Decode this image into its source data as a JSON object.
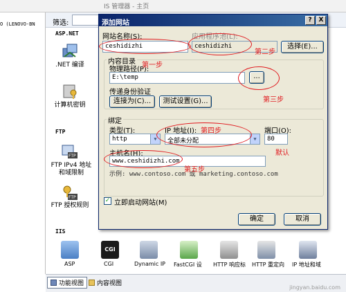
{
  "background": {
    "title_fragment": "IS 管理器 - 主页",
    "left_tree_text": "O (LENOVO-BN",
    "left_tree_text_right": "(LENOVO-BN",
    "filter_label": "筛选:",
    "sections": {
      "aspnet": "ASP.NET",
      "ftp": "FTP",
      "iis": "IIS"
    },
    "pane_icons": [
      {
        "label": ".NET 编译",
        "icon": "dotnet-compile-icon"
      },
      {
        "label": "计算机密钥",
        "icon": "machine-key-icon"
      },
      {
        "label": "FTP IPv4 地址和域限制",
        "icon": "ftp-ipv4-icon"
      },
      {
        "label": "FTP 授权规则",
        "icon": "ftp-authorization-icon"
      }
    ],
    "bottom_icons": [
      {
        "label": "ASP",
        "icon": "asp-icon"
      },
      {
        "label": "CGI",
        "icon": "cgi-icon"
      },
      {
        "label": "Dynamic IP",
        "icon": "dynamic-ip-icon"
      },
      {
        "label": "FastCGI 设",
        "icon": "fastcgi-icon"
      },
      {
        "label": "HTTP 响应标",
        "icon": "http-response-headers-icon"
      },
      {
        "label": "HTTP 重定向",
        "icon": "http-redirect-icon"
      },
      {
        "label": "IP 地址和域",
        "icon": "ip-domain-icon"
      }
    ],
    "status_tabs": [
      {
        "label": "功能视图",
        "icon": "features-view-icon",
        "active": true
      },
      {
        "label": "内容视图",
        "icon": "content-view-icon",
        "active": false
      }
    ],
    "watermark": "jingyan.baidu.com"
  },
  "dialog": {
    "title": "添加网站",
    "help_button": "?",
    "close_button": "X",
    "site_name": {
      "label": "网站名称(S):",
      "value": "ceshidizhi"
    },
    "app_pool": {
      "label": "应用程序池(L):",
      "value": "ceshidizhi",
      "select_button": "选择(E)..."
    },
    "content_dir": {
      "legend": "内容目录",
      "physical_path_label": "物理路径(P):",
      "physical_path_value": "E:\\temp",
      "browse_button": "...",
      "passthrough_label": "传递身份验证",
      "connect_as_button": "连接为(C)...",
      "test_settings_button": "测试设置(G)..."
    },
    "binding": {
      "legend": "绑定",
      "type_label": "类型(T):",
      "type_value": "http",
      "ip_label": "IP 地址(I):",
      "ip_value": "全部未分配",
      "port_label": "端口(O):",
      "port_value": "80",
      "hostname_label": "主机名(H):",
      "hostname_value": "www.ceshidizhi.com",
      "example_text": "示例: www.contoso.com 或 marketing.contoso.com"
    },
    "start_immediately": {
      "label": "立即启动网站(M)",
      "checked": true
    },
    "ok_button": "确定",
    "cancel_button": "取消"
  },
  "annotations": {
    "step1": "第一步",
    "step2": "第二步",
    "step3": "第三步",
    "step4": "第四步",
    "step5": "第五步",
    "default": "默认",
    "color": "#e0191e"
  }
}
